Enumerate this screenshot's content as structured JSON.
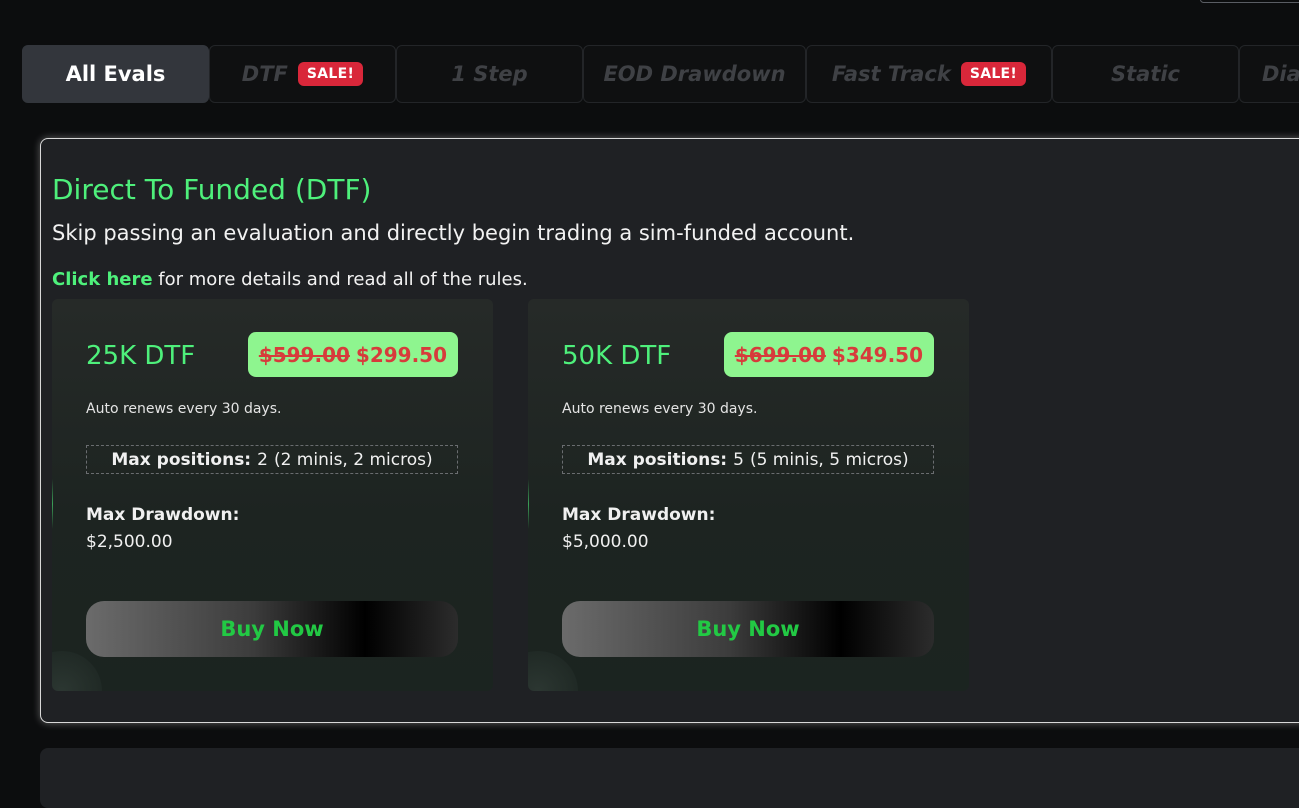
{
  "tabs": [
    {
      "label": "All Evals",
      "active": true,
      "badge": ""
    },
    {
      "label": "DTF",
      "active": false,
      "badge": "SALE!"
    },
    {
      "label": "1 Step",
      "active": false,
      "badge": ""
    },
    {
      "label": "EOD Drawdown",
      "active": false,
      "badge": ""
    },
    {
      "label": "Fast Track",
      "active": false,
      "badge": "SALE!"
    },
    {
      "label": "Static",
      "active": false,
      "badge": ""
    },
    {
      "label": "Dia",
      "active": false,
      "badge": ""
    }
  ],
  "section": {
    "title": "Direct To Funded (DTF)",
    "description": "Skip passing an evaluation and directly begin trading a sim-funded account.",
    "link_text": "Click here",
    "link_suffix": " for more details and read all of the rules."
  },
  "cards": [
    {
      "name": "25K DTF",
      "old_price": "$599.00",
      "new_price": "$299.50",
      "renew": "Auto renews every 30 days.",
      "max_positions_label": "Max positions:",
      "max_positions_value": "2",
      "max_positions_detail": "(2 minis, 2 micros)",
      "drawdown_label": "Max Drawdown:",
      "drawdown_value": "$2,500.00",
      "button": "Buy Now"
    },
    {
      "name": "50K DTF",
      "old_price": "$699.00",
      "new_price": "$349.50",
      "renew": "Auto renews every 30 days.",
      "max_positions_label": "Max positions:",
      "max_positions_value": "5",
      "max_positions_detail": "(5 minis, 5 micros)",
      "drawdown_label": "Max Drawdown:",
      "drawdown_value": "$5,000.00",
      "button": "Buy Now"
    }
  ],
  "colors": {
    "accent_green": "#4ef07b",
    "sale_red": "#d9273a",
    "price_bg": "#8ef58f",
    "buy_text": "#22c944"
  }
}
